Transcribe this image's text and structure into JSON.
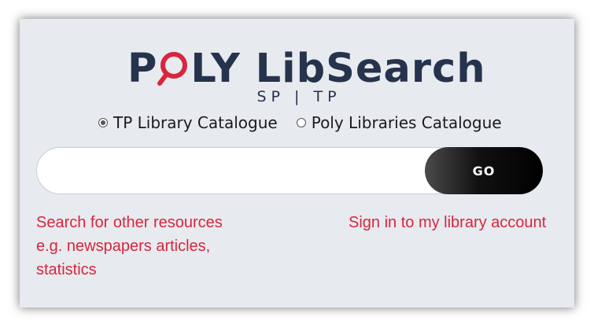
{
  "logo": {
    "part1": "P",
    "part2": "LY LibSearch",
    "subtitle": "SP | TP",
    "brand_color": "#26334d",
    "accent_color": "#d7263d"
  },
  "radios": [
    {
      "label": "TP Library Catalogue",
      "checked": true
    },
    {
      "label": "Poly Libraries Catalogue",
      "checked": false
    }
  ],
  "search": {
    "value": "",
    "placeholder": "",
    "go_label": "GO"
  },
  "links": {
    "other_resources_line1": "Search for other resources",
    "other_resources_line2": "e.g. newspapers articles,",
    "other_resources_line3": "statistics",
    "sign_in": "Sign in to my library account"
  }
}
